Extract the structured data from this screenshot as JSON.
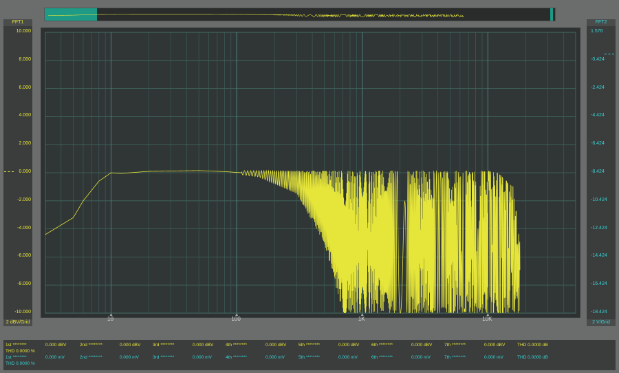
{
  "channels": {
    "left": {
      "label": "FFT1",
      "scale": "2 dBV/Grid",
      "color": "#e6e63a",
      "ticks": [
        "10.000",
        "8.000",
        "6.000",
        "4.000",
        "2.000",
        "0.000",
        "-2.000",
        "-4.000",
        "-6.000",
        "-8.000",
        "-10.000"
      ]
    },
    "right": {
      "label": "FFT2",
      "scale": "2 V/Grid",
      "color": "#38d4d4",
      "ticks": [
        "1.576",
        "-0.424",
        "-2.424",
        "-4.424",
        "-6.424",
        "-8.424",
        "-10.424",
        "-12.424",
        "-14.424",
        "-16.424",
        "-18.424"
      ]
    }
  },
  "x_axis": {
    "ticks": [
      "10",
      "100",
      "1K",
      "10K"
    ]
  },
  "chart_data": {
    "type": "line",
    "x_scale": "log",
    "xlim": [
      3,
      50000
    ],
    "ylim": [
      -10,
      10
    ],
    "ylabel": "",
    "xlabel": "",
    "grid": true,
    "series": [
      {
        "color": "#e6e63a",
        "envelope_upper": [
          [
            3,
            -4.4
          ],
          [
            5,
            -3.2
          ],
          [
            6,
            -2.0
          ],
          [
            8,
            -0.6
          ],
          [
            10,
            0.0
          ],
          [
            12,
            -0.05
          ],
          [
            20,
            0.1
          ],
          [
            50,
            0.2
          ],
          [
            100,
            0.15
          ],
          [
            300,
            0.15
          ],
          [
            1000,
            0.15
          ],
          [
            10000,
            0.15
          ],
          [
            12000,
            0.0
          ],
          [
            16000,
            -1.0
          ],
          [
            18000,
            -5.0
          ]
        ],
        "envelope_lower": [
          [
            3,
            -4.4
          ],
          [
            5,
            -3.2
          ],
          [
            6,
            -2.0
          ],
          [
            8,
            -0.6
          ],
          [
            10,
            0.0
          ],
          [
            12,
            -0.05
          ],
          [
            20,
            0.1
          ],
          [
            50,
            0.1
          ],
          [
            80,
            0.0
          ],
          [
            150,
            -0.3
          ],
          [
            300,
            -1.5
          ],
          [
            500,
            -5.0
          ],
          [
            700,
            -10.0
          ],
          [
            18000,
            -10.0
          ]
        ]
      }
    ]
  },
  "measurements": {
    "row1": {
      "harmonics": [
        {
          "label": "1st ********",
          "value": "0.000 dBV"
        },
        {
          "label": "2nd ********",
          "value": "0.000 dBV"
        },
        {
          "label": "3rd ********",
          "value": "0.000 dBV"
        },
        {
          "label": "4th ********",
          "value": "0.000 dBV"
        },
        {
          "label": "5th ********",
          "value": "0.000 dBV"
        },
        {
          "label": "6th ********",
          "value": "0.000 dBV"
        },
        {
          "label": "7th ********",
          "value": "0.000 dBV"
        }
      ],
      "thd_db": "THD 0.0000 dB",
      "thd_pct": "THD  0.0000 %"
    },
    "row2": {
      "harmonics": [
        {
          "label": "1st ********",
          "value": "0.000 mV"
        },
        {
          "label": "2nd ********",
          "value": "0.000 mV"
        },
        {
          "label": "3rd ********",
          "value": "0.000 mV"
        },
        {
          "label": "4th ********",
          "value": "0.000 mV"
        },
        {
          "label": "5th ********",
          "value": "0.000 mV"
        },
        {
          "label": "6th ********",
          "value": "0.000 mV"
        },
        {
          "label": "7th ********",
          "value": "0.000 mV"
        }
      ],
      "thd_db": "THD 0.0000 dB",
      "thd_pct": "THD  0.0000 %"
    }
  }
}
